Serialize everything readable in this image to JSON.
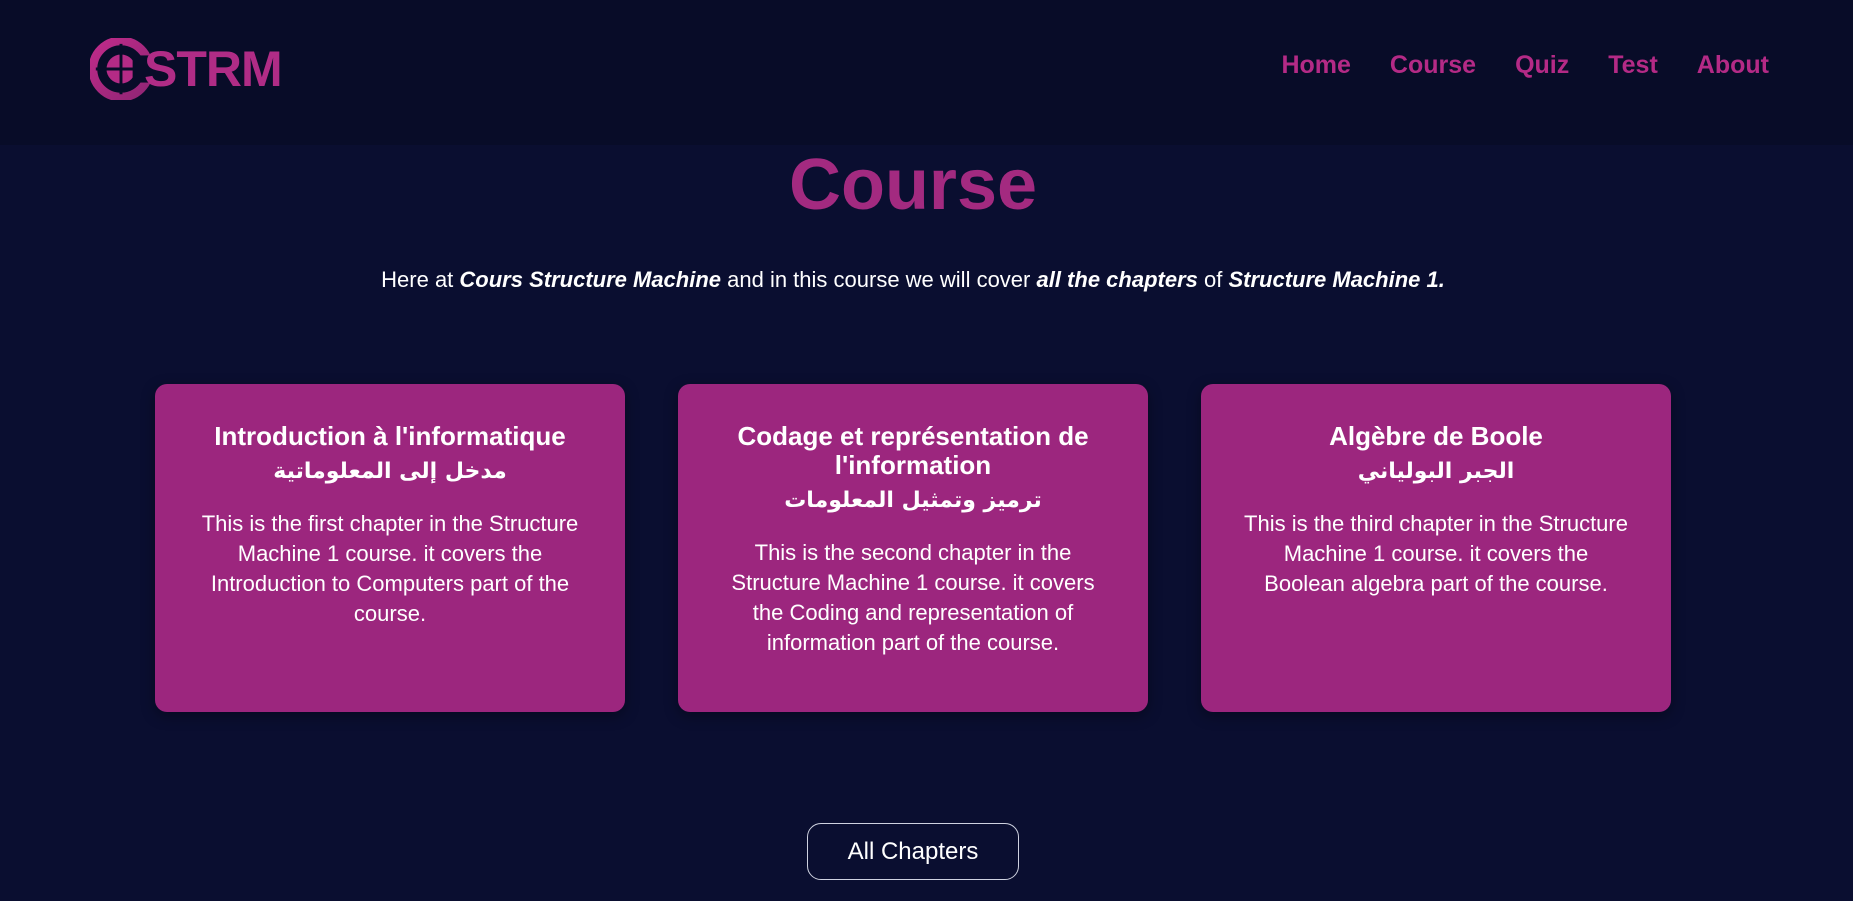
{
  "header": {
    "logo_text": "STRM",
    "nav": [
      "Home",
      "Course",
      "Quiz",
      "Test",
      "About"
    ]
  },
  "page": {
    "title": "Course",
    "intro": {
      "prefix": "Here at ",
      "site_name": "Cours Structure Machine",
      "middle": " and in this course we will cover ",
      "scope": "all the chapters",
      "connector": " of ",
      "course_name": "Structure Machine 1."
    }
  },
  "chapters": [
    {
      "title": "Introduction à l'informatique",
      "subtitle_ar": "مدخل إلى المعلوماتية",
      "description": "This is the first chapter in the Structure Machine 1 course. it covers the Introduction to Computers part of the course."
    },
    {
      "title": "Codage et représentation de l'information",
      "subtitle_ar": "ترميز وتمثيل المعلومات",
      "description": "This is the second chapter in the Structure Machine 1 course. it covers the Coding and representation of information part of the course."
    },
    {
      "title": "Algèbre de Boole",
      "subtitle_ar": "الجبر البولياني",
      "description": "This is the third chapter in the Structure Machine 1 course. it covers the Boolean algebra part of the course."
    }
  ],
  "cta_label": "All Chapters",
  "colors": {
    "background": "#0a0e30",
    "header": "#080c28",
    "accent": "#b02c86",
    "card": "#9c267e"
  },
  "icons": [
    "strm-logo-icon"
  ]
}
